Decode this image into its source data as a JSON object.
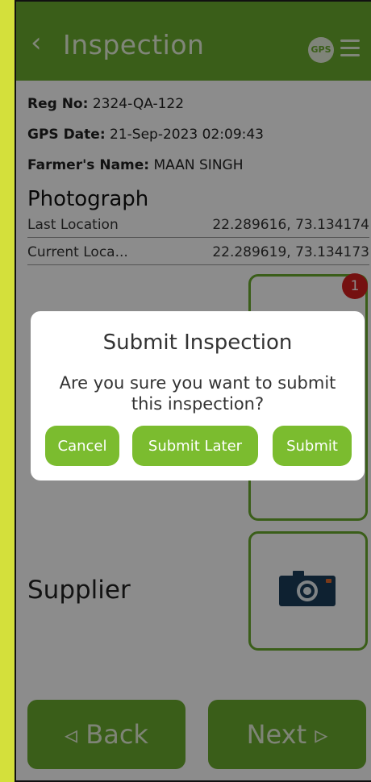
{
  "header": {
    "back_icon": "chevron-left-icon",
    "title": "Inspection",
    "gps_label": "GPS",
    "menu_icon": "hamburger-menu-icon"
  },
  "info": {
    "reg_label": "Reg No:",
    "reg_value": "2324-QA-122",
    "gps_date_label": "GPS Date:",
    "gps_date_value": "21-Sep-2023 02:09:43",
    "farmer_label": "Farmer's Name:",
    "farmer_value": "MAAN SINGH"
  },
  "photograph": {
    "title": "Photograph",
    "last_location_label": "Last Location",
    "last_location_value": "22.289616, 73.134174",
    "current_location_label": "Current Loca...",
    "current_location_value": "22.289619, 73.134173",
    "badge_count": "1"
  },
  "supplier": {
    "label": "Supplier",
    "camera_icon": "camera-icon"
  },
  "footer": {
    "back_label": "◃ Back",
    "next_label": "Next ▹"
  },
  "dialog": {
    "title": "Submit Inspection",
    "message": "Are you sure you want to submit this inspection?",
    "cancel_label": "Cancel",
    "submit_later_label": "Submit Later",
    "submit_label": "Submit"
  },
  "colors": {
    "primary": "#6bab2e",
    "button": "#7bbc2f",
    "badge": "#d62020",
    "background": "#d4e03b"
  }
}
